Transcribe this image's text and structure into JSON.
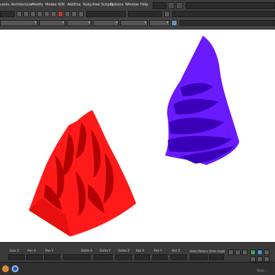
{
  "app": {
    "status_text": "Shad..."
  },
  "menubar": {
    "items": [
      "cents",
      "Architecture",
      "Modify",
      "Modes",
      "SDK",
      "AddOns",
      "Ruby",
      "Xtek Scripts",
      "Options",
      "Window",
      "Help"
    ]
  },
  "toolbar": {
    "dropdown_arrow": "▾"
  },
  "status_fields": {
    "labels": [
      "Size Z",
      "Pos X",
      "Pos Y",
      "Delta X",
      "Delta Y",
      "Delta Z",
      "Rot X",
      "Rot Y",
      "Rot Z",
      "Delta Distanc",
      "Delta Angle"
    ]
  },
  "icons": {
    "taskbar": [
      "camera-icon",
      "app-icon"
    ],
    "snap_green": "snap-icon",
    "snap_blue": "grid-icon"
  },
  "colors": {
    "red_object": "#ff1a1a",
    "red_shadow": "#b30000",
    "purple_object": "#6a1aff",
    "purple_shadow": "#3a00b8",
    "ui_dark": "#3d3d3d"
  }
}
